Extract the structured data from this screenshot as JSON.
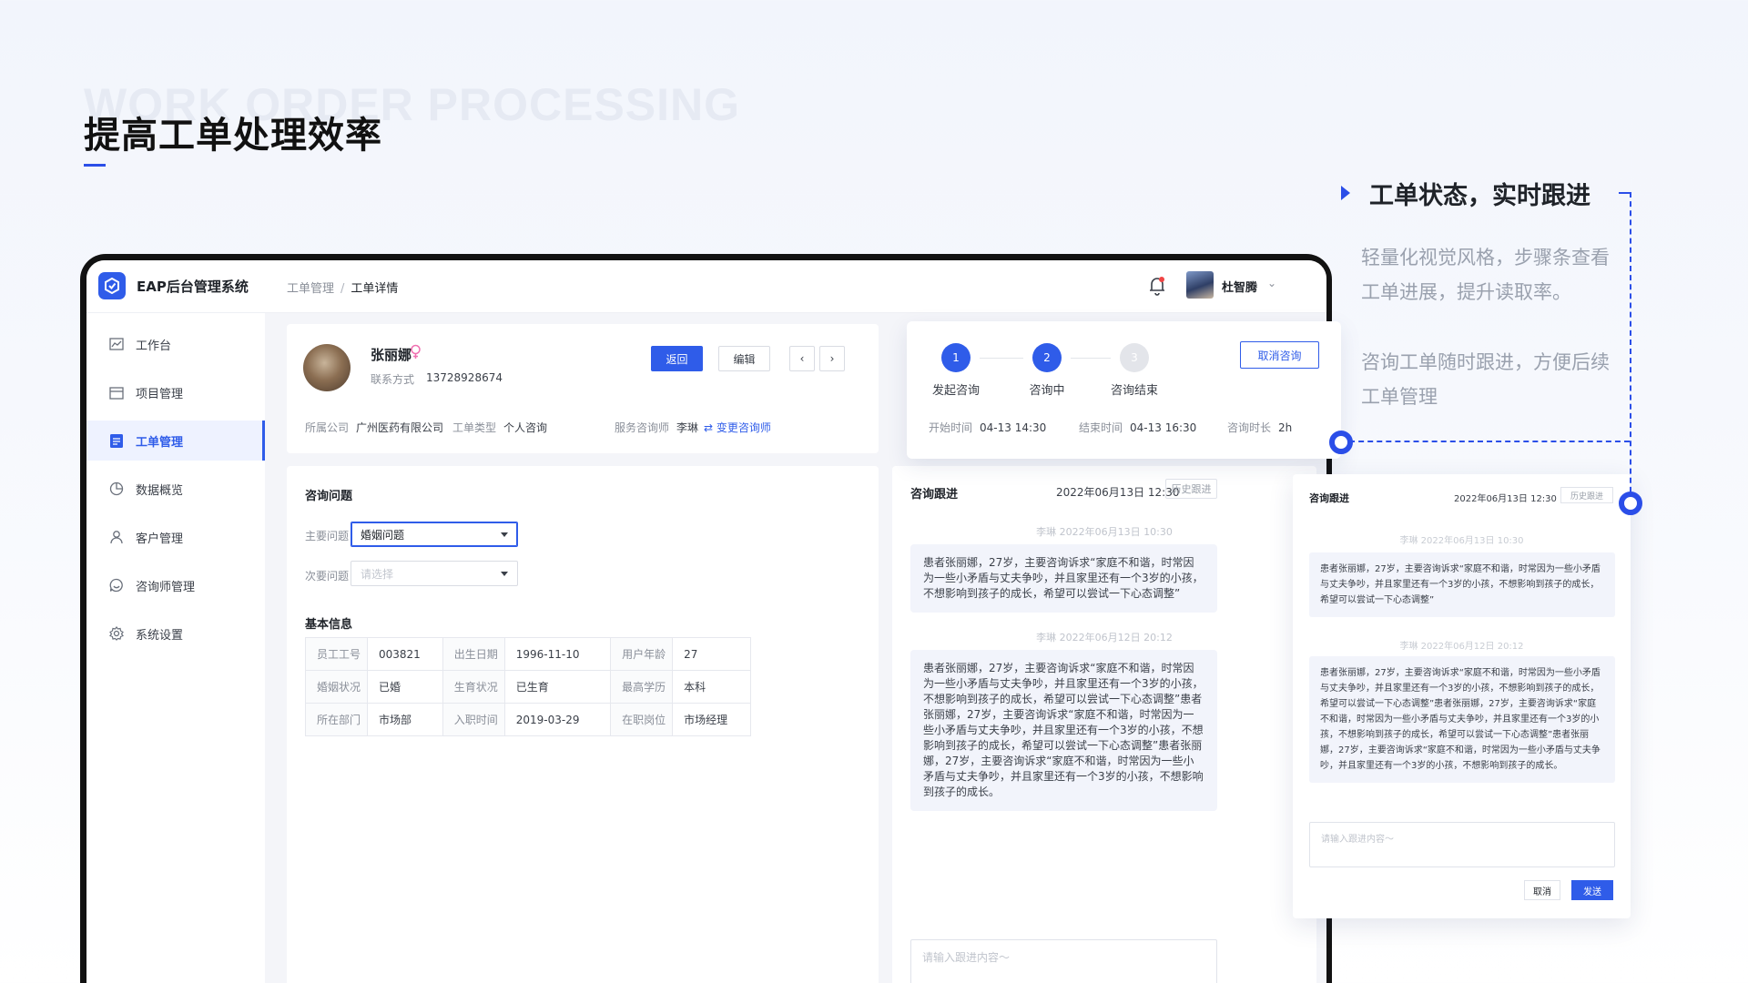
{
  "hero": {
    "bg_text": "WORK ORDER PROCESSING",
    "title": "提高工单处理效率"
  },
  "feature": {
    "title": "工单状态，实时跟进",
    "desc1": "轻量化视觉风格，步骤条查看工单进展，提升读取率。",
    "desc2": "咨询工单随时跟进，方便后续工单管理"
  },
  "app": {
    "title": "EAP后台管理系统",
    "breadcrumb": [
      "工单管理",
      "/",
      "工单详情"
    ],
    "user": {
      "name": "杜智腾"
    }
  },
  "sidebar": {
    "items": [
      {
        "label": "工作台",
        "icon": "chart-line-icon",
        "active": false
      },
      {
        "label": "项目管理",
        "icon": "calendar-icon",
        "active": false
      },
      {
        "label": "工单管理",
        "icon": "clipboard-list-icon",
        "active": true
      },
      {
        "label": "数据概览",
        "icon": "pie-chart-icon",
        "active": false
      },
      {
        "label": "客户管理",
        "icon": "user-icon",
        "active": false
      },
      {
        "label": "咨询师管理",
        "icon": "chat-smile-icon",
        "active": false
      },
      {
        "label": "系统设置",
        "icon": "gear-icon",
        "active": false
      }
    ]
  },
  "profile": {
    "name": "张丽娜",
    "gender": "female",
    "contact_label": "联系方式",
    "contact": "13728928674",
    "buttons": {
      "back": "返回",
      "edit": "编辑",
      "prev": "‹",
      "next": "›"
    },
    "company_label": "所属公司",
    "company": "广州医药有限公司",
    "type_label": "工单类型",
    "type": "个人咨询",
    "counselor_label": "服务咨询师",
    "counselor": "李琳",
    "change_link": "⇄ 变更咨询师"
  },
  "form": {
    "section_title": "咨询问题",
    "main_label": "主要问题",
    "main_value": "婚姻问题",
    "secondary_label": "次要问题",
    "secondary_placeholder": "请选择"
  },
  "basic": {
    "section_title": "基本信息",
    "rows": [
      [
        [
          "员工工号",
          "003821"
        ],
        [
          "出生日期",
          "1996-11-10"
        ],
        [
          "用户年龄",
          "27"
        ]
      ],
      [
        [
          "婚姻状况",
          "已婚"
        ],
        [
          "生育状况",
          "已生育"
        ],
        [
          "最高学历",
          "本科"
        ]
      ],
      [
        [
          "所在部门",
          "市场部"
        ],
        [
          "入职时间",
          "2019-03-29"
        ],
        [
          "在职岗位",
          "市场经理"
        ]
      ]
    ]
  },
  "progress": {
    "steps": [
      {
        "num": "1",
        "label": "发起咨询",
        "state": "done"
      },
      {
        "num": "2",
        "label": "咨询中",
        "state": "done"
      },
      {
        "num": "3",
        "label": "咨询结束",
        "state": "todo"
      }
    ],
    "cancel": "取消咨询",
    "start_label": "开始时间",
    "start": "04-13 14:30",
    "end_label": "结束时间",
    "end": "04-13 16:30",
    "duration_label": "咨询时长",
    "duration": "2h"
  },
  "chat": {
    "title": "咨询跟进",
    "date": "2022年06月13日 12:30",
    "history_btn": "历史跟进",
    "messages": [
      {
        "head": "李琳  2022年06月13日 10:30",
        "text": "患者张丽娜，27岁，主要咨询诉求“家庭不和谐，时常因为一些小矛盾与丈夫争吵，并且家里还有一个3岁的小孩，不想影响到孩子的成长，希望可以尝试一下心态调整”"
      },
      {
        "head": "李琳  2022年06月12日 20:12",
        "text": "患者张丽娜，27岁，主要咨询诉求“家庭不和谐，时常因为一些小矛盾与丈夫争吵，并且家里还有一个3岁的小孩，不想影响到孩子的成长，希望可以尝试一下心态调整”患者张丽娜，27岁，主要咨询诉求“家庭不和谐，时常因为一些小矛盾与丈夫争吵，并且家里还有一个3岁的小孩，不想影响到孩子的成长，希望可以尝试一下心态调整”患者张丽娜，27岁，主要咨询诉求“家庭不和谐，时常因为一些小矛盾与丈夫争吵，并且家里还有一个3岁的小孩，不想影响到孩子的成长。"
      }
    ],
    "input_placeholder": "请输入跟进内容～",
    "cancel": "取消",
    "send": "发送"
  },
  "colors": {
    "accent": "#2f5ce9",
    "bg": "#f4f5f9"
  }
}
